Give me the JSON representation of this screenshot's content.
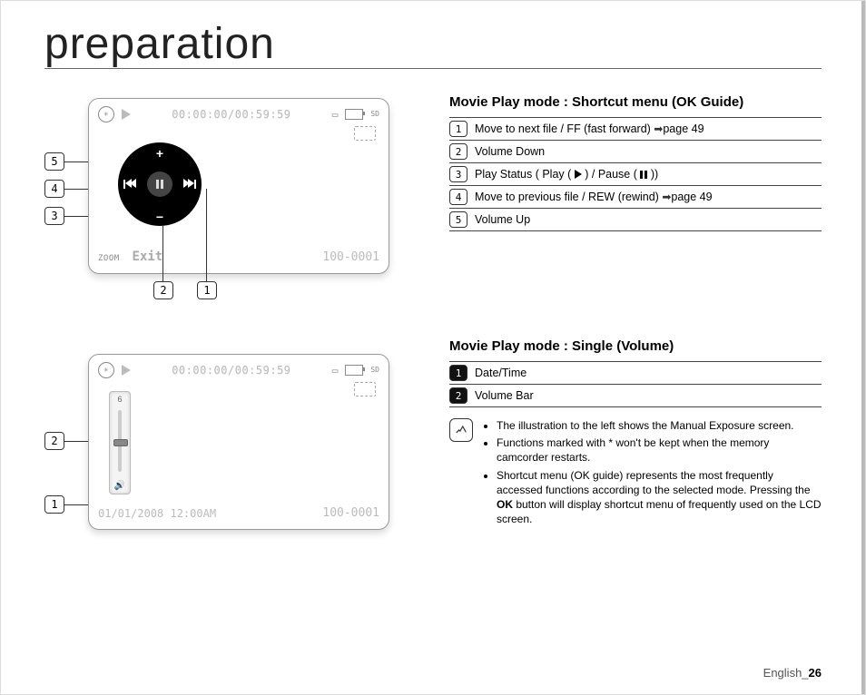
{
  "title": "preparation",
  "ok_guide": {
    "heading": "Movie Play mode : Shortcut menu (OK Guide)",
    "rows": [
      {
        "n": "1",
        "text": "Move to next file / FF (fast forward)",
        "pageref": "page 49"
      },
      {
        "n": "2",
        "text": "Volume Down"
      },
      {
        "n": "3",
        "text": "Play Status ( Play (  ) / Pause (  ))",
        "has_play_pause": true
      },
      {
        "n": "4",
        "text": "Move to previous file / REW (rewind)",
        "pageref": "page 49"
      },
      {
        "n": "5",
        "text": "Volume Up"
      }
    ],
    "screen": {
      "timer": "00:00:00/00:59:59",
      "zoom_label": "ZOOM",
      "exit_label": "Exit",
      "file_number": "100-0001"
    },
    "callouts_left": [
      "5",
      "4",
      "3"
    ],
    "callouts_bottom": [
      "2",
      "1"
    ]
  },
  "single": {
    "heading": "Movie Play mode : Single (Volume)",
    "rows": [
      {
        "n": "1",
        "text": "Date/Time"
      },
      {
        "n": "2",
        "text": "Volume Bar"
      }
    ],
    "screen": {
      "timer": "00:00:00/00:59:59",
      "datetime": "01/01/2008  12:00AM",
      "file_number": "100-0001",
      "vol_level": "6"
    },
    "callouts_left": [
      "2",
      "1"
    ]
  },
  "notes": [
    "The illustration to the left shows the Manual Exposure screen.",
    "Functions marked with * won't be kept when the memory camcorder restarts.",
    "Shortcut menu (OK guide) represents the most frequently accessed functions according to the selected mode. Pressing the OK button will display shortcut menu of frequently used on the LCD screen."
  ],
  "note_ok_word": "OK",
  "footer_lang": "English",
  "footer_page": "26"
}
